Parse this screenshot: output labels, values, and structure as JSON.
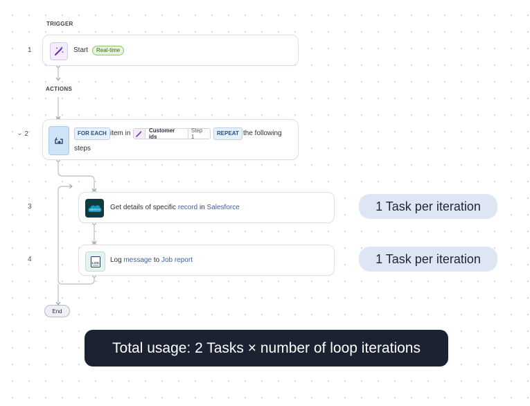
{
  "trigger_label": "TRIGGER",
  "actions_label": "ACTIONS",
  "steps": {
    "s1": {
      "number": "1",
      "title": "Start",
      "badge": "Real-time"
    },
    "s2": {
      "number": "2",
      "collapse_glyph": "›",
      "for_each": "FOR EACH",
      "item_in": "item in",
      "ref_label": "Customer ids",
      "ref_step": "Step 1",
      "repeat": "REPEAT",
      "the_following": "the following",
      "steps_word": "steps"
    },
    "s3": {
      "number": "3",
      "prefix": "Get details of specific",
      "obj": "record",
      "in": "in",
      "app": "Salesforce",
      "icon_text": "salesforce"
    },
    "s4": {
      "number": "4",
      "prefix": "Log",
      "obj": "message",
      "to": "to",
      "target": "Job report",
      "icon_text": "LOG"
    }
  },
  "pills": {
    "p3": "1 Task per iteration",
    "p4": "1 Task per iteration"
  },
  "end_label": "End",
  "total_usage": "Total usage: 2 Tasks × number of loop iterations",
  "icons": {
    "start": "magic-wand-icon",
    "loop": "loop-repeat-icon",
    "salesforce": "salesforce-cloud-icon",
    "log": "log-document-icon"
  },
  "colors": {
    "wand": "#6b2fb3",
    "wand_bg": "#f3ecfb",
    "loop_bg": "#cfe3f6",
    "salesforce_bg": "#0f3b3f",
    "salesforce_cloud": "#1798c1",
    "log_bg": "#e3f4ee",
    "connector": "#b8bdc7",
    "link": "#3b5fa8"
  }
}
